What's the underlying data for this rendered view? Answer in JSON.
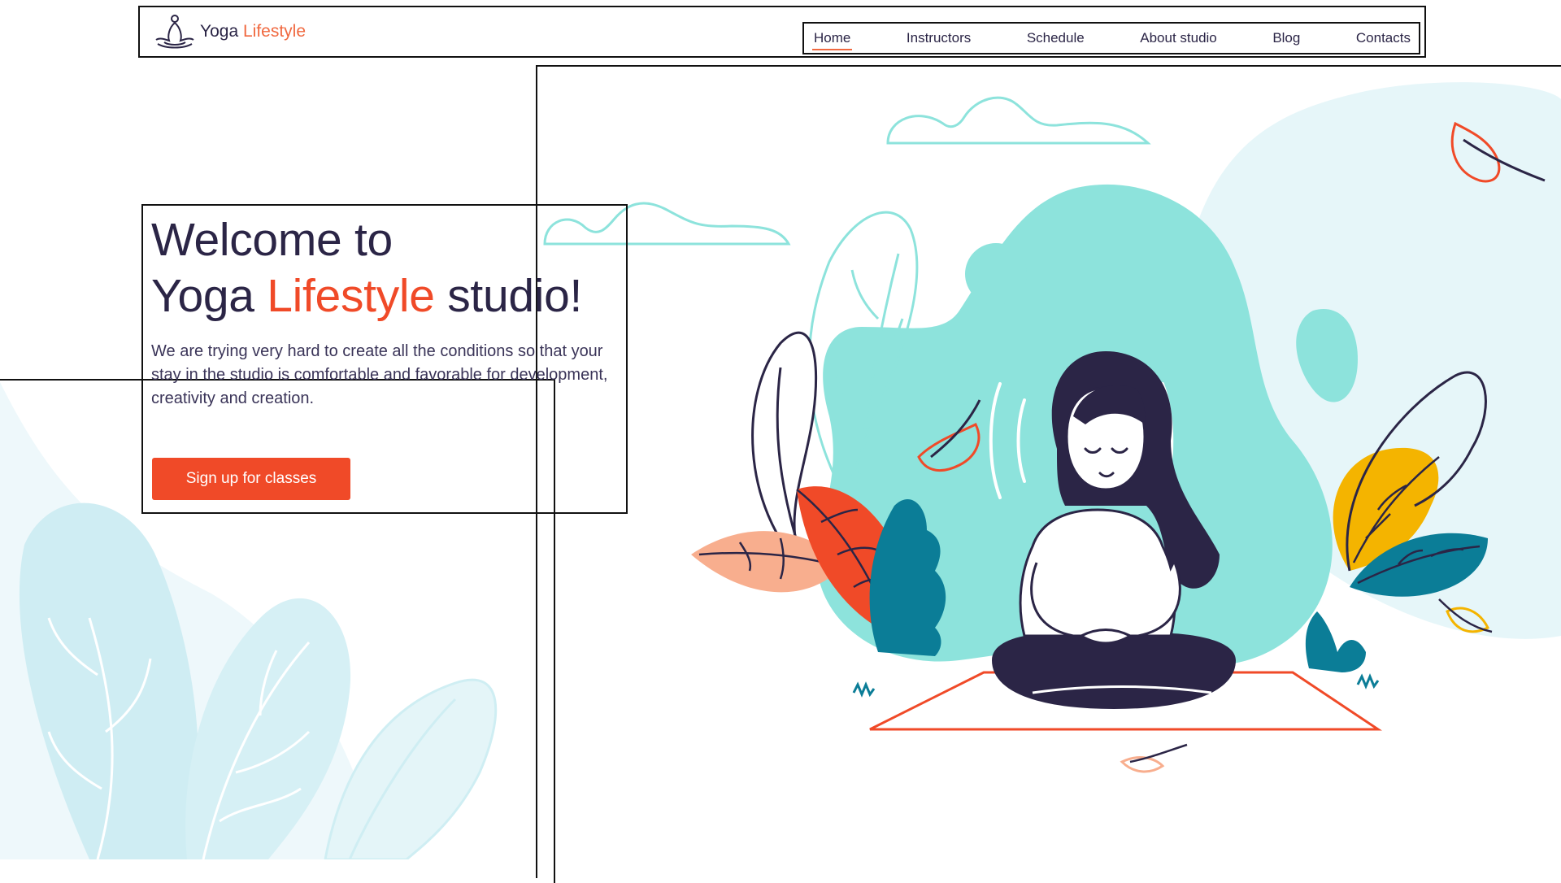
{
  "brand": {
    "name_part1": "Yoga",
    "name_part2": "Lifestyle"
  },
  "nav": {
    "items": [
      {
        "label": "Home",
        "active": true
      },
      {
        "label": "Instructors"
      },
      {
        "label": "Schedule"
      },
      {
        "label": "About studio"
      },
      {
        "label": "Blog"
      },
      {
        "label": "Contacts"
      }
    ]
  },
  "hero": {
    "title_line1": "Welcome to",
    "title_word1": "Yoga",
    "title_accent": "Lifestyle",
    "title_word3": "studio!",
    "description": "We are trying very hard to create all the conditions so that your stay in the studio is comfortable and favorable for development, creativity and creation.",
    "cta_label": "Sign up for classes"
  },
  "colors": {
    "accent": "#f04a28",
    "text_dark": "#2b2546",
    "teal": "#8de3dc",
    "light_blue": "#d8f0f4"
  },
  "icons": [
    "meditation-logo-icon"
  ],
  "illustration": "woman-meditating-illustration"
}
